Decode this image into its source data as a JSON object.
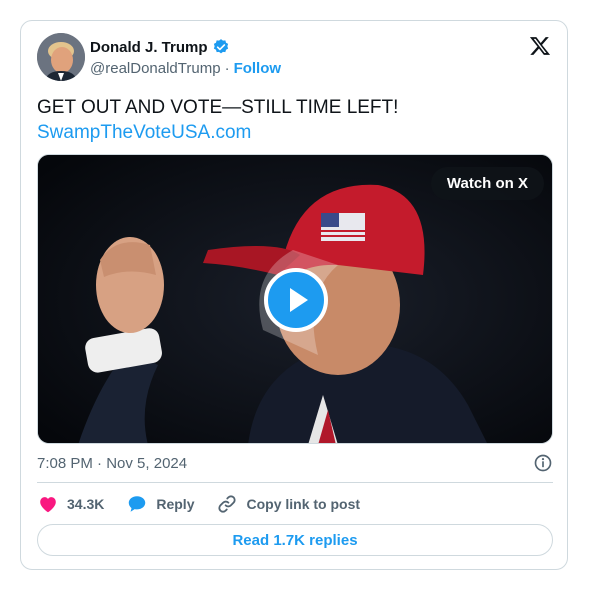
{
  "author": {
    "name": "Donald J. Trump",
    "handle": "@realDonaldTrump",
    "separator": "·",
    "follow_label": "Follow"
  },
  "tweet": {
    "text": "GET OUT AND VOTE—STILL TIME LEFT!",
    "link": "SwampTheVoteUSA.com"
  },
  "media": {
    "watch_label": "Watch on X"
  },
  "meta": {
    "time": "7:08 PM",
    "separator": "·",
    "date": "Nov 5, 2024"
  },
  "actions": {
    "likes": "34.3K",
    "reply_label": "Reply",
    "copy_label": "Copy link to post"
  },
  "replies_button": "Read 1.7K replies",
  "colors": {
    "accent": "#1d9bf0",
    "like": "#f91880",
    "muted": "#536471",
    "border": "#cfd9de"
  },
  "icons": [
    "verified-badge-icon",
    "x-logo-icon",
    "play-icon",
    "heart-icon",
    "reply-bubble-icon",
    "link-icon",
    "info-icon"
  ]
}
